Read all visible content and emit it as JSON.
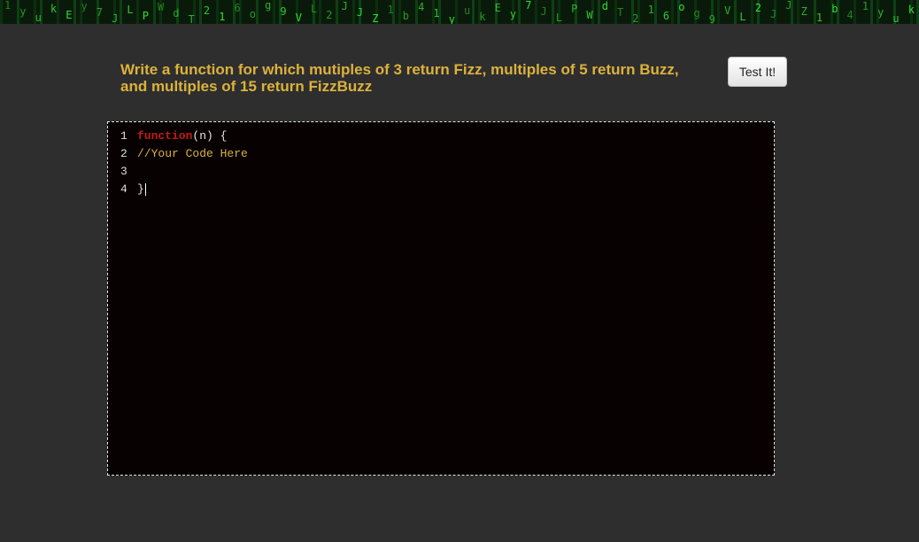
{
  "banner": {
    "glyphs": "1 y u k E y 7 J L P W d T 2 1 6 o g 9 V L 2 J J Z 1 b 4"
  },
  "prompt": {
    "line1": "Write a function for which mutiples of 3 return Fizz, multiples of 5 return Buzz,",
    "line2": "and multiples of 15 return FizzBuzz"
  },
  "toolbar": {
    "test_label": "Test It!"
  },
  "editor": {
    "line_numbers": [
      "1",
      "2",
      "3",
      "4"
    ],
    "line1": {
      "keyword": "function",
      "rest": "(n) {"
    },
    "line2": {
      "comment": "//Your Code Here"
    },
    "line3": {
      "text": ""
    },
    "line4": {
      "text": "}"
    }
  },
  "colors": {
    "background": "#2e2e2e",
    "prompt": "#dcb23c",
    "editor_bg": "#070101",
    "keyword": "#c41a16",
    "comment": "#dcb23c",
    "banner_glyph": "#3cff3c"
  }
}
